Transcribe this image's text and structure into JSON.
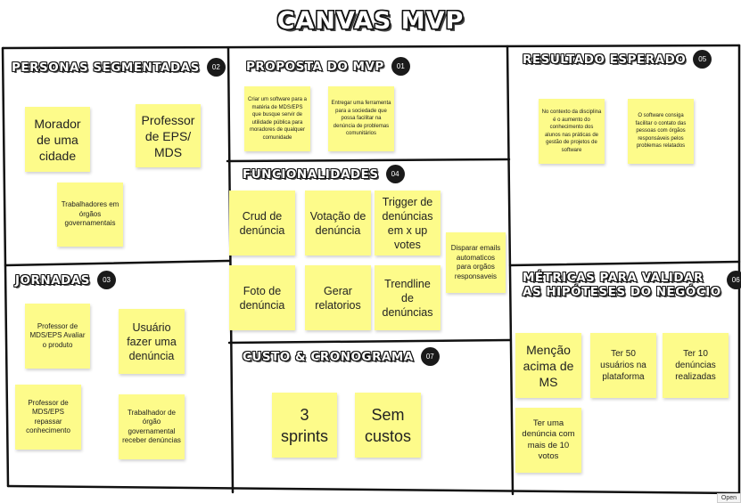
{
  "title": "Canvas MVP",
  "sections": {
    "personas": {
      "label": "Personas Segmentadas",
      "num": "02",
      "notes": [
        "Morador de uma cidade",
        "Professor de EPS/ MDS",
        "Trabalhadores em órgãos governamentais"
      ]
    },
    "proposta": {
      "label": "Proposta do MVP",
      "num": "01",
      "notes": [
        "Criar um software para a matéria de MDS/EPS que busque servir de utilidade pública para moradores de qualquer comunidade",
        "Entregar uma ferramenta para a sociedade que possa facilitar na denúncia de problemas comunitários"
      ]
    },
    "resultado": {
      "label": "Resultado Esperado",
      "num": "05",
      "notes": [
        "No contexto da disciplina é o aumento do conhecimento dos alunos nas práticas de gestão de projetos de software",
        "O software consiga facilitar o contato das pessoas com órgãos responsáveis pelos problemas relatados"
      ]
    },
    "funcionalidades": {
      "label": "Funcionalidades",
      "num": "04",
      "notes": [
        "Crud de denúncia",
        "Votação de denúncia",
        "Trigger de denúncias em x up votes",
        "Disparar emails automaticos para orgãos responsaveis",
        "Foto de denúncia",
        "Gerar relatorios",
        "Trendline de denúncias"
      ]
    },
    "jornadas": {
      "label": "Jornadas",
      "num": "03",
      "notes": [
        "Professor de MDS/EPS Avaliar o produto",
        "Usuário fazer uma denúncia",
        "Professor de MDS/EPS repassar conhecimento",
        "Trabalhador de órgão governamental receber denúncias"
      ]
    },
    "metricas": {
      "label_line1": "Métricas para validar",
      "label_line2": "as hipóteses do negócio",
      "num": "06",
      "notes": [
        "Menção acima de MS",
        "Ter 50 usuários na plataforma",
        "Ter 10 denúncias realizadas",
        "Ter uma denúncia com mais de 10 votos"
      ]
    },
    "custo": {
      "label": "Custo & Cronograma",
      "num": "07",
      "notes": [
        "3 sprints",
        "Sem custos"
      ]
    }
  },
  "footer": {
    "open_label": "Open"
  },
  "colors": {
    "sticky": "#fdfb8a",
    "line": "#111111",
    "badge": "#1a1a1a"
  }
}
